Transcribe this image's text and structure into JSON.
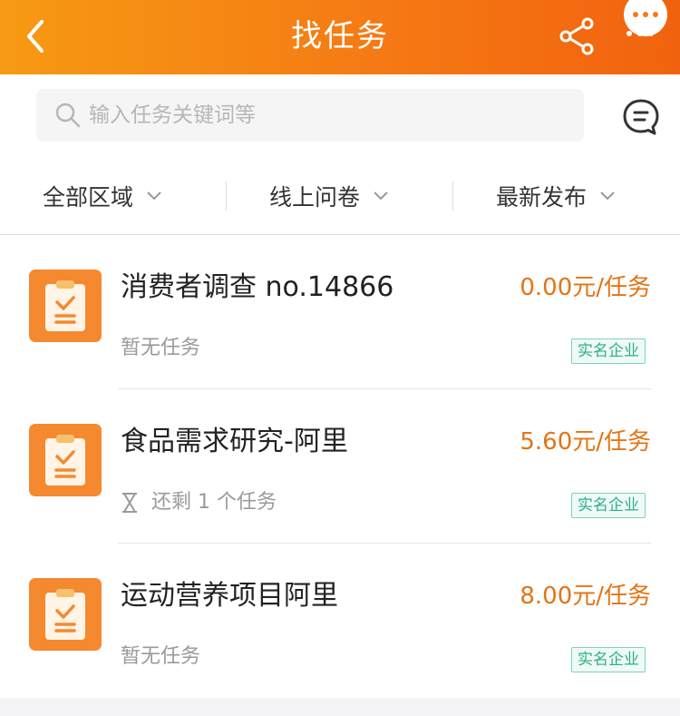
{
  "header": {
    "title": "找任务",
    "back_icon": "chevron-left-icon",
    "share_icon": "share-icon",
    "more_icon": "more-dots-icon"
  },
  "search": {
    "placeholder": "输入任务关键词等",
    "search_icon": "search-icon",
    "message_icon": "chat-bubble-icon"
  },
  "filters": [
    {
      "label": "全部区域"
    },
    {
      "label": "线上问卷"
    },
    {
      "label": "最新发布"
    }
  ],
  "tasks": [
    {
      "name": "消费者调查 no.14866",
      "price": "0.00元/任务",
      "status": "暂无任务",
      "badge": "实名企业",
      "show_hourglass": false
    },
    {
      "name": "食品需求研究-阿里",
      "price": "5.60元/任务",
      "status": "还剩 1 个任务",
      "badge": "实名企业",
      "show_hourglass": true
    },
    {
      "name": "运动营养项目阿里",
      "price": "8.00元/任务",
      "status": "暂无任务",
      "badge": "实名企业",
      "show_hourglass": false
    }
  ],
  "colors": {
    "header_gradient": [
      "#f79a13",
      "#f2620e"
    ],
    "accent_price": "#e37415",
    "task_icon_bg": "#f5892f",
    "badge_text": "#2fae8a"
  }
}
